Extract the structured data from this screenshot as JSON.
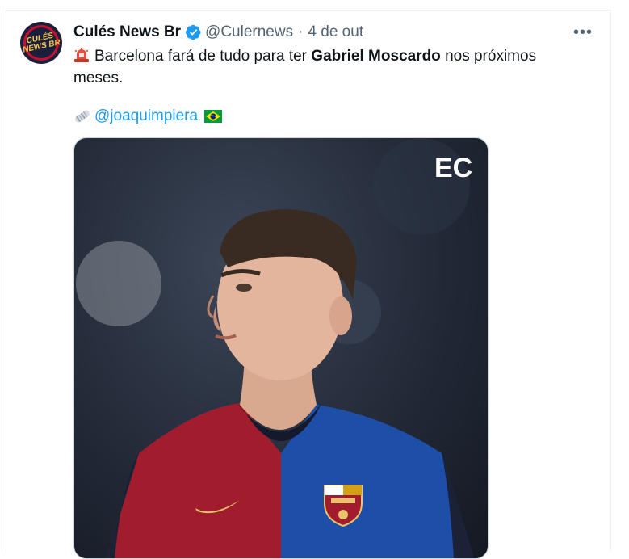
{
  "tweet": {
    "display_name": "Culés News Br",
    "handle": "@Culernews",
    "separator": "·",
    "time": "4 de out",
    "more_label": "•••",
    "avatar_text_line1": "CULÉS",
    "avatar_text_line2": "NEWS BR",
    "text_before": "Barcelona fará de tudo para ter ",
    "text_bold": "Gabriel Moscardo",
    "text_after": " nos próximos meses.",
    "mention": "@joaquimpiera",
    "media_watermark": "EC"
  },
  "icons": {
    "verified": "verified-badge-icon",
    "siren": "police-siren-emoji",
    "newspaper": "rolled-newspaper-emoji",
    "flag": "brazil-flag-emoji",
    "more": "more-options-icon"
  },
  "colors": {
    "accent": "#1d9bf0",
    "secondary_text": "#536471",
    "barca_blue": "#1e4fa8",
    "barca_red": "#a11c2c"
  }
}
